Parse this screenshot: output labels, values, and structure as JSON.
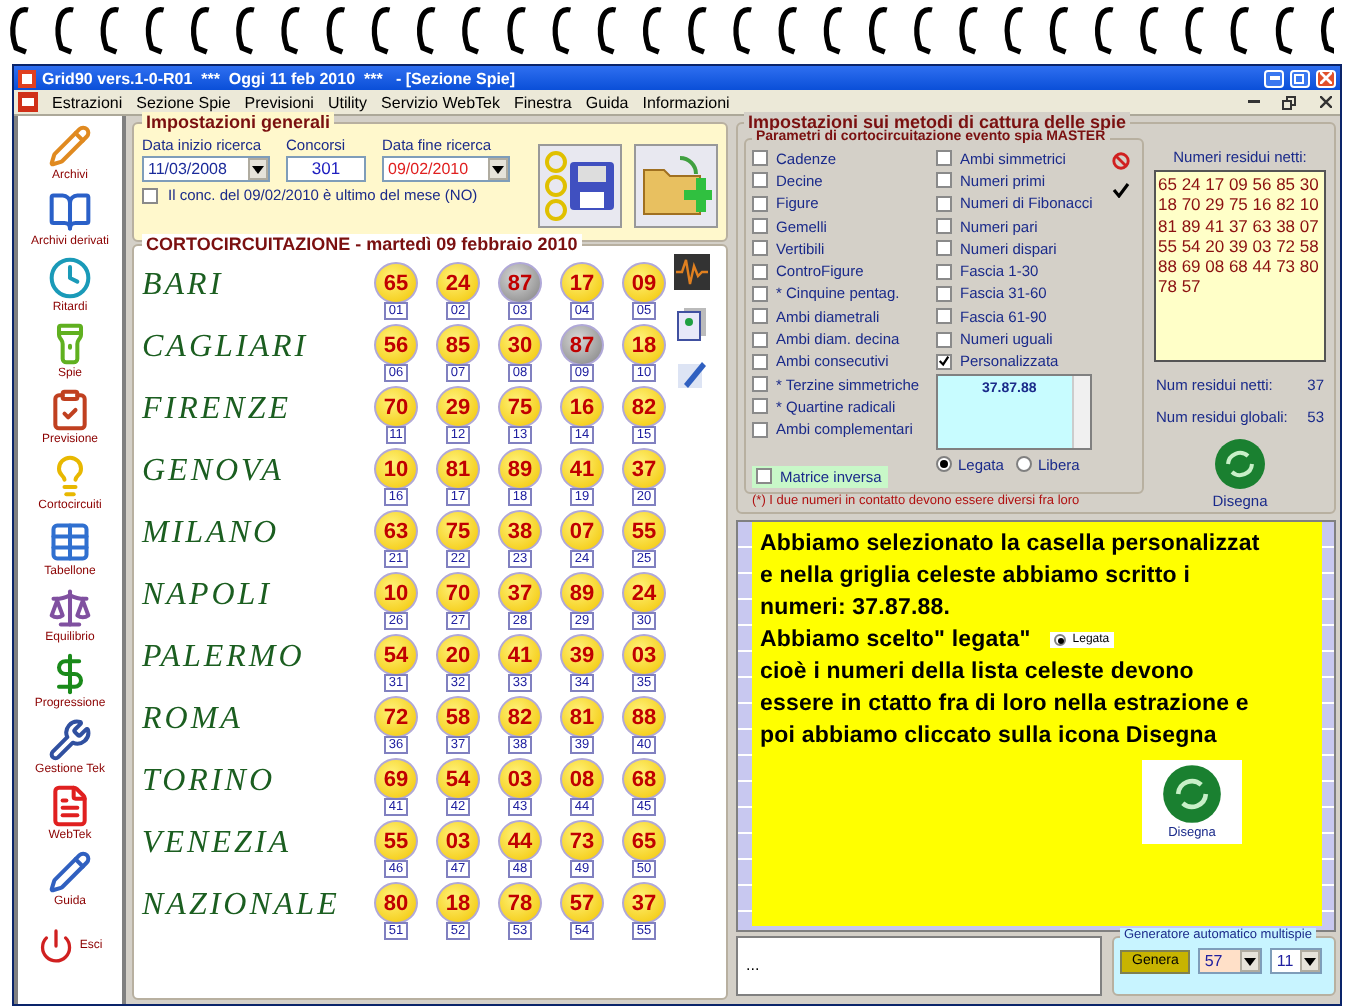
{
  "window": {
    "title": "Grid90 vers.1-0-R01  ***  Oggi 11 feb 2010  ***   - [Sezione Spie]"
  },
  "menu": [
    "Estrazioni",
    "Sezione Spie",
    "Previsioni",
    "Utility",
    "Servizio WebTek",
    "Finestra",
    "Guida",
    "Informazioni"
  ],
  "sidebar": [
    {
      "label": "Archivi",
      "kind": "pencil"
    },
    {
      "label": "Archivi derivati",
      "kind": "book"
    },
    {
      "label": "Ritardi",
      "kind": "clock"
    },
    {
      "label": "Spie",
      "kind": "flashlight"
    },
    {
      "label": "Previsione",
      "kind": "clipboard"
    },
    {
      "label": "Cortocircuiti",
      "kind": "bulb"
    },
    {
      "label": "Tabellone",
      "kind": "table"
    },
    {
      "label": "Equilibrio",
      "kind": "scales"
    },
    {
      "label": "Progressione",
      "kind": "dollar"
    },
    {
      "label": "Gestione Tek",
      "kind": "tools"
    },
    {
      "label": "WebTek",
      "kind": "letter"
    },
    {
      "label": "Guida",
      "kind": "guide"
    },
    {
      "label": "Esci",
      "kind": "power"
    }
  ],
  "general_settings": {
    "title": "Impostazioni generali",
    "start_date": {
      "label": "Data inizio ricerca",
      "value": "11/03/2008"
    },
    "contests": {
      "label": "Concorsi",
      "value": "301"
    },
    "end_date": {
      "label": "Data fine ricerca",
      "value": "09/02/2010"
    },
    "last_of_month": {
      "label": "Il conc. del 09/02/2010 è ultimo del mese (NO)",
      "checked": false
    }
  },
  "short_circuit": {
    "title": "CORTOCIRCUITAZIONE - martedì 09 febbraio 2010",
    "wheels": [
      {
        "name": "BARI",
        "numbers": [
          {
            "value": "65",
            "index": "01",
            "selected": false
          },
          {
            "value": "24",
            "index": "02",
            "selected": false
          },
          {
            "value": "87",
            "index": "03",
            "selected": true
          },
          {
            "value": "17",
            "index": "04",
            "selected": false
          },
          {
            "value": "09",
            "index": "05",
            "selected": false
          }
        ]
      },
      {
        "name": "CAGLIARI",
        "numbers": [
          {
            "value": "56",
            "index": "06",
            "selected": false
          },
          {
            "value": "85",
            "index": "07",
            "selected": false
          },
          {
            "value": "30",
            "index": "08",
            "selected": false
          },
          {
            "value": "87",
            "index": "09",
            "selected": true
          },
          {
            "value": "18",
            "index": "10",
            "selected": false
          }
        ]
      },
      {
        "name": "FIRENZE",
        "numbers": [
          {
            "value": "70",
            "index": "11",
            "selected": false
          },
          {
            "value": "29",
            "index": "12",
            "selected": false
          },
          {
            "value": "75",
            "index": "13",
            "selected": false
          },
          {
            "value": "16",
            "index": "14",
            "selected": false
          },
          {
            "value": "82",
            "index": "15",
            "selected": false
          }
        ]
      },
      {
        "name": "GENOVA",
        "numbers": [
          {
            "value": "10",
            "index": "16",
            "selected": false
          },
          {
            "value": "81",
            "index": "17",
            "selected": false
          },
          {
            "value": "89",
            "index": "18",
            "selected": false
          },
          {
            "value": "41",
            "index": "19",
            "selected": false
          },
          {
            "value": "37",
            "index": "20",
            "selected": false
          }
        ]
      },
      {
        "name": "MILANO",
        "numbers": [
          {
            "value": "63",
            "index": "21",
            "selected": false
          },
          {
            "value": "75",
            "index": "22",
            "selected": false
          },
          {
            "value": "38",
            "index": "23",
            "selected": false
          },
          {
            "value": "07",
            "index": "24",
            "selected": false
          },
          {
            "value": "55",
            "index": "25",
            "selected": false
          }
        ]
      },
      {
        "name": "NAPOLI",
        "numbers": [
          {
            "value": "10",
            "index": "26",
            "selected": false
          },
          {
            "value": "70",
            "index": "27",
            "selected": false
          },
          {
            "value": "37",
            "index": "28",
            "selected": false
          },
          {
            "value": "89",
            "index": "29",
            "selected": false
          },
          {
            "value": "24",
            "index": "30",
            "selected": false
          }
        ]
      },
      {
        "name": "PALERMO",
        "numbers": [
          {
            "value": "54",
            "index": "31",
            "selected": false
          },
          {
            "value": "20",
            "index": "32",
            "selected": false
          },
          {
            "value": "41",
            "index": "33",
            "selected": false
          },
          {
            "value": "39",
            "index": "34",
            "selected": false
          },
          {
            "value": "03",
            "index": "35",
            "selected": false
          }
        ]
      },
      {
        "name": "ROMA",
        "numbers": [
          {
            "value": "72",
            "index": "36",
            "selected": false
          },
          {
            "value": "58",
            "index": "37",
            "selected": false
          },
          {
            "value": "82",
            "index": "38",
            "selected": false
          },
          {
            "value": "81",
            "index": "39",
            "selected": false
          },
          {
            "value": "88",
            "index": "40",
            "selected": false
          }
        ]
      },
      {
        "name": "TORINO",
        "numbers": [
          {
            "value": "69",
            "index": "41",
            "selected": false
          },
          {
            "value": "54",
            "index": "42",
            "selected": false
          },
          {
            "value": "03",
            "index": "43",
            "selected": false
          },
          {
            "value": "08",
            "index": "44",
            "selected": false
          },
          {
            "value": "68",
            "index": "45",
            "selected": false
          }
        ]
      },
      {
        "name": "VENEZIA",
        "numbers": [
          {
            "value": "55",
            "index": "46",
            "selected": false
          },
          {
            "value": "03",
            "index": "47",
            "selected": false
          },
          {
            "value": "44",
            "index": "48",
            "selected": false
          },
          {
            "value": "73",
            "index": "49",
            "selected": false
          },
          {
            "value": "65",
            "index": "50",
            "selected": false
          }
        ]
      },
      {
        "name": "NAZIONALE",
        "numbers": [
          {
            "value": "80",
            "index": "51",
            "selected": false
          },
          {
            "value": "18",
            "index": "52",
            "selected": false
          },
          {
            "value": "78",
            "index": "53",
            "selected": false
          },
          {
            "value": "57",
            "index": "54",
            "selected": false
          },
          {
            "value": "37",
            "index": "55",
            "selected": false
          }
        ]
      }
    ]
  },
  "capture_settings": {
    "title": "Impostazioni sui metodi di cattura delle spie",
    "parameters": {
      "title": "Parametri di cortocircuitazione evento spia MASTER",
      "column_1": [
        {
          "label": "Cadenze",
          "checked": false
        },
        {
          "label": "Decine",
          "checked": false
        },
        {
          "label": "Figure",
          "checked": false
        },
        {
          "label": "Gemelli",
          "checked": false
        },
        {
          "label": "Vertibili",
          "checked": false
        },
        {
          "label": "ControFigure",
          "checked": false
        },
        {
          "label": "* Cinquine pentag.",
          "checked": false
        },
        {
          "label": "Ambi diametrali",
          "checked": false
        },
        {
          "label": "Ambi diam. decina",
          "checked": false
        },
        {
          "label": "Ambi consecutivi",
          "checked": false
        },
        {
          "label": "* Terzine simmetriche",
          "checked": false
        },
        {
          "label": "* Quartine radicali",
          "checked": false
        },
        {
          "label": "Ambi complementari",
          "checked": false
        }
      ],
      "column_2": [
        {
          "label": "Ambi simmetrici",
          "checked": false
        },
        {
          "label": "Numeri primi",
          "checked": false
        },
        {
          "label": "Numeri di Fibonacci",
          "checked": false
        },
        {
          "label": "Numeri pari",
          "checked": false
        },
        {
          "label": "Numeri dispari",
          "checked": false
        },
        {
          "label": "Fascia 1-30",
          "checked": false
        },
        {
          "label": "Fascia 31-60",
          "checked": false
        },
        {
          "label": "Fascia 61-90",
          "checked": false
        },
        {
          "label": "Numeri uguali",
          "checked": false
        },
        {
          "label": "Personalizzata",
          "checked": true
        }
      ],
      "custom_numbers": "37.87.88",
      "link_mode": [
        {
          "label": "Legata",
          "selected": true
        },
        {
          "label": "Libera",
          "selected": false
        }
      ],
      "reverse_matrix": {
        "label": "Matrice inversa",
        "checked": false
      },
      "note": "(*) I due numeri in contatto devono essere diversi fra loro"
    },
    "residuals": {
      "title": "Numeri residui netti:",
      "numbers": "65 24 17 09 56 85 30 18 70 29 75 16 82 10 81 89 41 37 63 38 07 55 54 20 39 03 72 58 88 69 08 68 44 73 80 78 57",
      "net": {
        "label": "Num residui netti:",
        "value": "37"
      },
      "global": {
        "label": "Num residui globali:",
        "value": "53"
      },
      "draw_button": "Disegna"
    }
  },
  "annotation": {
    "lines": [
      {
        "text": "Abbiamo selezionato la casella personalizzat"
      },
      {
        "text": "e nella griglia celeste abbiamo scritto i"
      },
      {
        "text": "numeri: 37.87.88."
      },
      {
        "text": "Abbiamo scelto\" legata\"",
        "radio": {
          "label": "Legata",
          "selected": true
        }
      },
      {
        "text": "cioè i numeri della lista celeste devono"
      },
      {
        "text": "essere in ctatto fra di loro nella estrazione e"
      },
      {
        "text": "poi abbiamo cliccato sulla icona Disegna"
      }
    ],
    "image_label": "Disegna"
  },
  "status_field": "...",
  "generator": {
    "title": "Generatore automatico multispie",
    "button": "Genera",
    "first": "57",
    "second": "11"
  }
}
